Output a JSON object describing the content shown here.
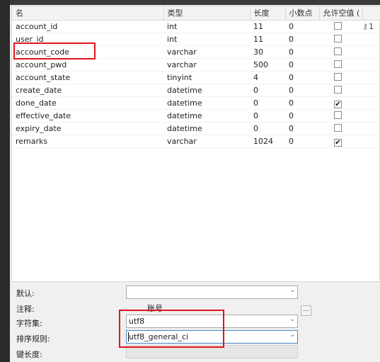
{
  "grid": {
    "columns": [
      "名",
      "类型",
      "长度",
      "小数点",
      "允许空值 (",
      ""
    ],
    "rows": [
      {
        "name": "account_id",
        "type": "int",
        "length": "11",
        "decimals": "0",
        "nullable": false,
        "key": "1"
      },
      {
        "name": "user_id",
        "type": "int",
        "length": "11",
        "decimals": "0",
        "nullable": false,
        "key": ""
      },
      {
        "name": "account_code",
        "type": "varchar",
        "length": "30",
        "decimals": "0",
        "nullable": false,
        "key": ""
      },
      {
        "name": "account_pwd",
        "type": "varchar",
        "length": "500",
        "decimals": "0",
        "nullable": false,
        "key": ""
      },
      {
        "name": "account_state",
        "type": "tinyint",
        "length": "4",
        "decimals": "0",
        "nullable": false,
        "key": ""
      },
      {
        "name": "create_date",
        "type": "datetime",
        "length": "0",
        "decimals": "0",
        "nullable": false,
        "key": ""
      },
      {
        "name": "done_date",
        "type": "datetime",
        "length": "0",
        "decimals": "0",
        "nullable": true,
        "key": ""
      },
      {
        "name": "effective_date",
        "type": "datetime",
        "length": "0",
        "decimals": "0",
        "nullable": false,
        "key": ""
      },
      {
        "name": "expiry_date",
        "type": "datetime",
        "length": "0",
        "decimals": "0",
        "nullable": false,
        "key": ""
      },
      {
        "name": "remarks",
        "type": "varchar",
        "length": "1024",
        "decimals": "0",
        "nullable": true,
        "key": ""
      }
    ],
    "selected_row_marker": "I",
    "key_icon": "key-icon"
  },
  "properties": {
    "default_label": "默认:",
    "default_value": "",
    "comment_label": "注释:",
    "comment_value": "账号",
    "comment_button": "...",
    "charset_label": "字符集:",
    "charset_value": "utf8",
    "collation_label": "排序规则:",
    "collation_value": "utf8_general_ci",
    "keylength_label": "键长度:",
    "keylength_value": ""
  },
  "icons": {
    "dropdown": "chevron-down-icon",
    "check": "checkmark-icon"
  },
  "colors": {
    "highlight": "#e0141c",
    "active_border": "#4a86c5"
  }
}
